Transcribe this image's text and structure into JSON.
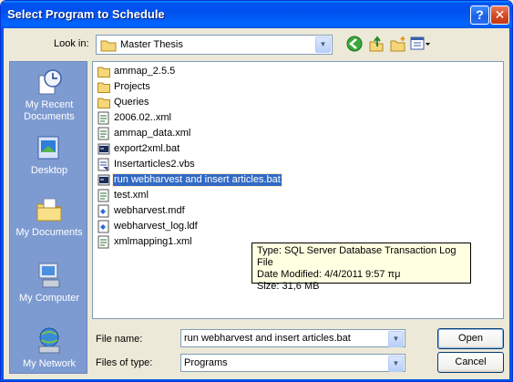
{
  "window": {
    "title": "Select Program to Schedule"
  },
  "titlebar": {
    "help_glyph": "?",
    "close_glyph": "✕"
  },
  "toolbar": {
    "look_in_label": "Look in:",
    "look_in_value": "Master Thesis",
    "icons": [
      "back-icon",
      "up-folder-icon",
      "new-folder-icon",
      "views-menu-icon"
    ]
  },
  "places": [
    {
      "label": "My Recent Documents",
      "icon": "recent-documents-icon"
    },
    {
      "label": "Desktop",
      "icon": "desktop-icon"
    },
    {
      "label": "My Documents",
      "icon": "my-documents-icon"
    },
    {
      "label": "My Computer",
      "icon": "my-computer-icon"
    },
    {
      "label": "My Network",
      "icon": "my-network-icon"
    }
  ],
  "files": [
    {
      "name": "ammap_2.5.5",
      "type": "folder"
    },
    {
      "name": "Projects",
      "type": "folder"
    },
    {
      "name": "Queries",
      "type": "folder"
    },
    {
      "name": "2006.02..xml",
      "type": "xml"
    },
    {
      "name": "ammap_data.xml",
      "type": "xml"
    },
    {
      "name": "export2xml.bat",
      "type": "bat"
    },
    {
      "name": "Insertarticles2.vbs",
      "type": "vbs"
    },
    {
      "name": "run webharvest and insert articles.bat",
      "type": "bat",
      "selected": true
    },
    {
      "name": "test.xml",
      "type": "xml"
    },
    {
      "name": "webharvest.mdf",
      "type": "db"
    },
    {
      "name": "webharvest_log.ldf",
      "type": "db"
    },
    {
      "name": "xmlmapping1.xml",
      "type": "xml"
    }
  ],
  "tooltip": {
    "line1": "Type: SQL Server Database Transaction Log File",
    "line2": "Date Modified: 4/4/2011 9:57 πμ",
    "line3": "Size: 31,6 MB"
  },
  "form": {
    "file_name_label": "File name:",
    "file_name_value": "run webharvest and insert articles.bat",
    "files_of_type_label": "Files of type:",
    "files_of_type_value": "Programs"
  },
  "buttons": {
    "open": "Open",
    "cancel": "Cancel"
  }
}
